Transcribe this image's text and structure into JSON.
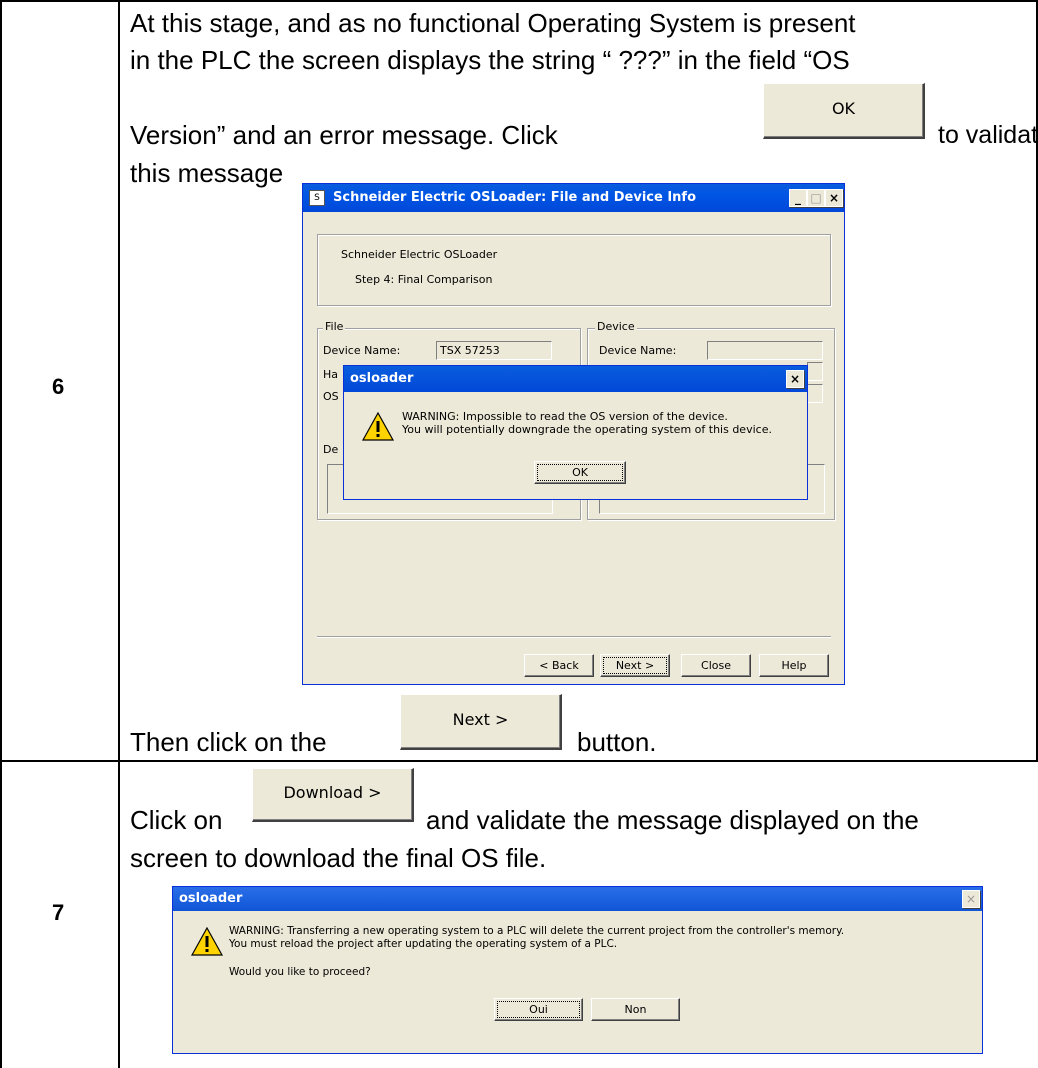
{
  "steps": [
    {
      "number": "6",
      "text_line1": "At this stage, and as no functional Operating System is present",
      "text_line2": "in the PLC the screen displays the string “ ???” in the field “OS",
      "text_line3_before": "Version” and an error message. Click",
      "text_line3_after": "to validate",
      "text_line4": "this message",
      "inline_button": "OK",
      "footer_before": "Then click on the",
      "footer_button": "Next >",
      "footer_after": "button."
    },
    {
      "number": "7",
      "text_line1_before": "Click on",
      "inline_button": "Download >",
      "text_line1_after": "and validate the message displayed on the",
      "text_line2": "screen to download the final OS file."
    }
  ],
  "osloader_window": {
    "title": "Schneider Electric OSLoader: File and Device Info",
    "header_title": "Schneider Electric OSLoader",
    "header_step": "Step 4: Final Comparison",
    "file_group": {
      "label": "File",
      "device_name_label": "Device Name:",
      "device_name_value": "TSX 57253",
      "hardware_label_partial": "Ha",
      "os_label_partial": "OS",
      "desc_label_partial": "De"
    },
    "device_group": {
      "label": "Device",
      "device_name_label": "Device Name:",
      "device_name_value": ""
    },
    "buttons": {
      "back": "< Back",
      "next": "Next >",
      "close": "Close",
      "help": "Help"
    },
    "controls": {
      "minimize": "_",
      "maximize": "□",
      "close": "×"
    }
  },
  "warning_dialog_1": {
    "title": "osloader",
    "line1": "WARNING: Impossible to read the OS version of the device.",
    "line2": "You will potentially downgrade the operating system of this device.",
    "ok": "OK",
    "close": "×"
  },
  "warning_dialog_2": {
    "title": "osloader",
    "line1": "WARNING: Transferring a new operating system to a PLC will delete the current project from the controller's  memory.",
    "line2": "You must reload  the project after updating the operating system of a PLC.",
    "question": "Would you like to proceed?",
    "yes": "Oui",
    "no": "Non",
    "close": "×"
  }
}
